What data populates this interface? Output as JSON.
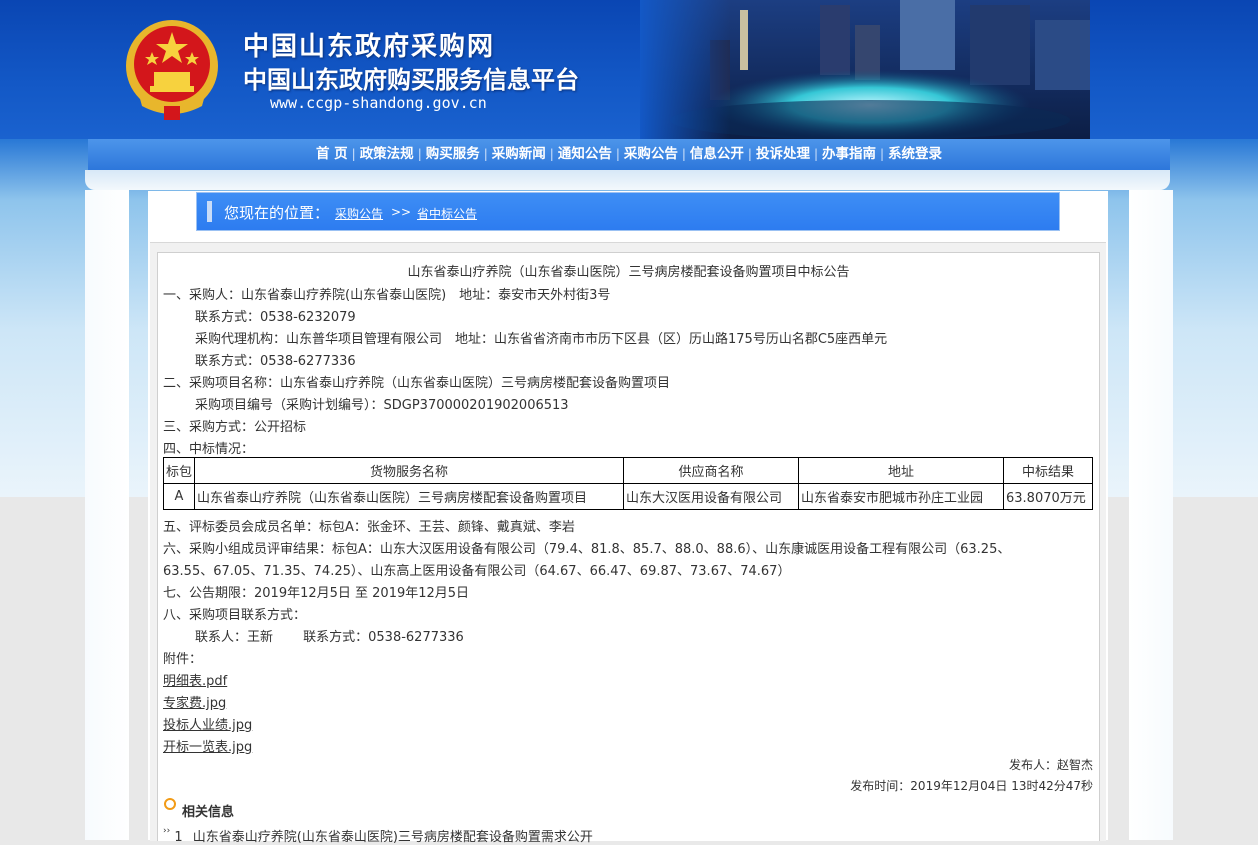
{
  "header": {
    "title_line1": "中国山东政府采购网",
    "title_line2": "中国山东政府购买服务信息平台",
    "url": "www.ccgp-shandong.gov.cn"
  },
  "nav": {
    "items": [
      {
        "label": "首 页"
      },
      {
        "label": "政策法规"
      },
      {
        "label": "购买服务"
      },
      {
        "label": "采购新闻"
      },
      {
        "label": "通知公告"
      },
      {
        "label": "采购公告"
      },
      {
        "label": "信息公开"
      },
      {
        "label": "投诉处理"
      },
      {
        "label": "办事指南"
      },
      {
        "label": "系统登录"
      }
    ]
  },
  "breadcrumb": {
    "title": "您现在的位置：",
    "level1": "采购公告",
    "separator": ">>",
    "level2": "省中标公告"
  },
  "notice": {
    "title": "山东省泰山疗养院（山东省泰山医院）三号病房楼配套设备购置项目中标公告",
    "lines": [
      "一、采购人：山东省泰山疗养院(山东省泰山医院)　地址：泰安市天外村街3号",
      "联系方式：0538-6232079",
      "采购代理机构：山东普华项目管理有限公司　地址：山东省省济南市市历下区县（区）历山路175号历山名郡C5座西单元",
      "联系方式：0538-6277336",
      "二、采购项目名称：山东省泰山疗养院（山东省泰山医院）三号病房楼配套设备购置项目",
      "采购项目编号（采购计划编号）：SDGP370000201902006513",
      "三、采购方式：公开招标",
      "四、中标情况："
    ],
    "table": {
      "headers": [
        "标包",
        "货物服务名称",
        "供应商名称",
        "地址",
        "中标结果"
      ],
      "rows": [
        [
          "A",
          "山东省泰山疗养院（山东省泰山医院）三号病房楼配套设备购置项目",
          "山东大汉医用设备有限公司",
          "山东省泰安市肥城市孙庄工业园",
          "63.8070万元"
        ]
      ]
    },
    "lines_after": [
      "五、评标委员会成员名单：标包A：张金环、王芸、颜锋、戴真斌、李岩",
      "六、采购小组成员评审结果：标包A：山东大汉医用设备有限公司（79.4、81.8、85.7、88.0、88.6）、山东康诚医用设备工程有限公司（63.25、",
      "63.55、67.05、71.35、74.25）、山东高上医用设备有限公司（64.67、66.47、69.87、73.67、74.67）",
      "七、公告期限：2019年12月5日 至 2019年12月5日",
      "八、采购项目联系方式：",
      "联系人：王新　　 联系方式：0538-6277336",
      "附件："
    ],
    "attachments": [
      "明细表.pdf",
      "专家费.jpg",
      "投标人业绩.jpg",
      "开标一览表.jpg"
    ],
    "publisher": "发布人：赵智杰",
    "publish_time": "发布时间：2019年12月04日 13时42分47秒"
  },
  "related": {
    "title": "相关信息",
    "items": [
      {
        "index": "1",
        "text": "山东省泰山疗养院(山东省泰山医院)三号病房楼配套设备购置需求公开"
      }
    ]
  },
  "colors": {
    "banner": "#1358c6",
    "nav": "#2d77db",
    "breadcrumb": "#2d7cf0",
    "accent_orange": "#f29b16"
  }
}
